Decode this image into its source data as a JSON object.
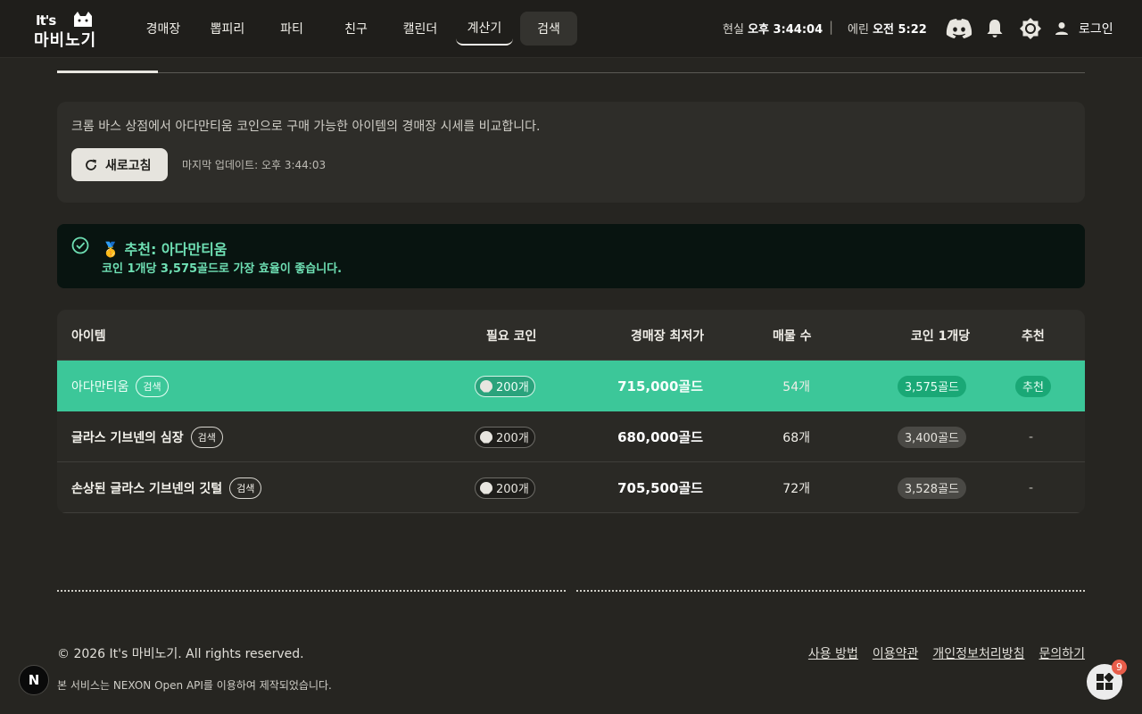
{
  "header": {
    "logo_top": "It's",
    "logo_bottom": "마비노기",
    "nav": [
      "경매장",
      "뽑피리",
      "파티",
      "친구",
      "캘린더",
      "계산기",
      "검색"
    ],
    "real_time_label": "현실",
    "real_time_value": "오후 3:44:04",
    "separator": "|",
    "erinn_time_label": "에린",
    "erinn_time_value": "오전 5:22",
    "login_label": "로그인",
    "icons": [
      "discord-icon",
      "bell-icon",
      "brightness-icon",
      "user-icon"
    ]
  },
  "info": {
    "description": "크롬 바스 상점에서 아다만티움 코인으로 구매 가능한 아이템의 경매장 시세를 비교합니다.",
    "refresh_label": "새로고침",
    "last_update": "마지막 업데이트: 오후 3:44:03"
  },
  "recommendation": {
    "medal": "🥇",
    "title": "추천: 아다만티움",
    "description": "코인 1개당 3,575골드로 가장 효율이 좋습니다."
  },
  "table": {
    "headers": {
      "item": "아이템",
      "coins": "필요 코인",
      "lowest": "경매장 최저가",
      "listings": "매물 수",
      "per_coin": "코인 1개당",
      "recommend": "추천"
    },
    "search_chip": "검색",
    "rows": [
      {
        "name": "아다만티움",
        "coins": "200개",
        "price": "715,000골드",
        "count": "54개",
        "per_coin": "3,575골드",
        "recommend": "추천"
      },
      {
        "name": "글라스 기브넨의 심장",
        "coins": "200개",
        "price": "680,000골드",
        "count": "68개",
        "per_coin": "3,400골드",
        "recommend": "-"
      },
      {
        "name": "손상된 글라스 기브넨의 깃털",
        "coins": "200개",
        "price": "705,500골드",
        "count": "72개",
        "per_coin": "3,528골드",
        "recommend": "-"
      }
    ]
  },
  "footer": {
    "copyright": "© 2026 It's 마비노기. All rights reserved.",
    "api_note": "본 서비스는 NEXON Open API를 이용하여 제작되었습니다.",
    "links": [
      "사용 방법",
      "이용약관",
      "개인정보처리방침",
      "문의하기"
    ],
    "n_badge": "N",
    "widget_count": "9"
  },
  "colors": {
    "accent_green": "#3cc799",
    "rec_text": "#6fe0b4",
    "background": "#262521"
  }
}
